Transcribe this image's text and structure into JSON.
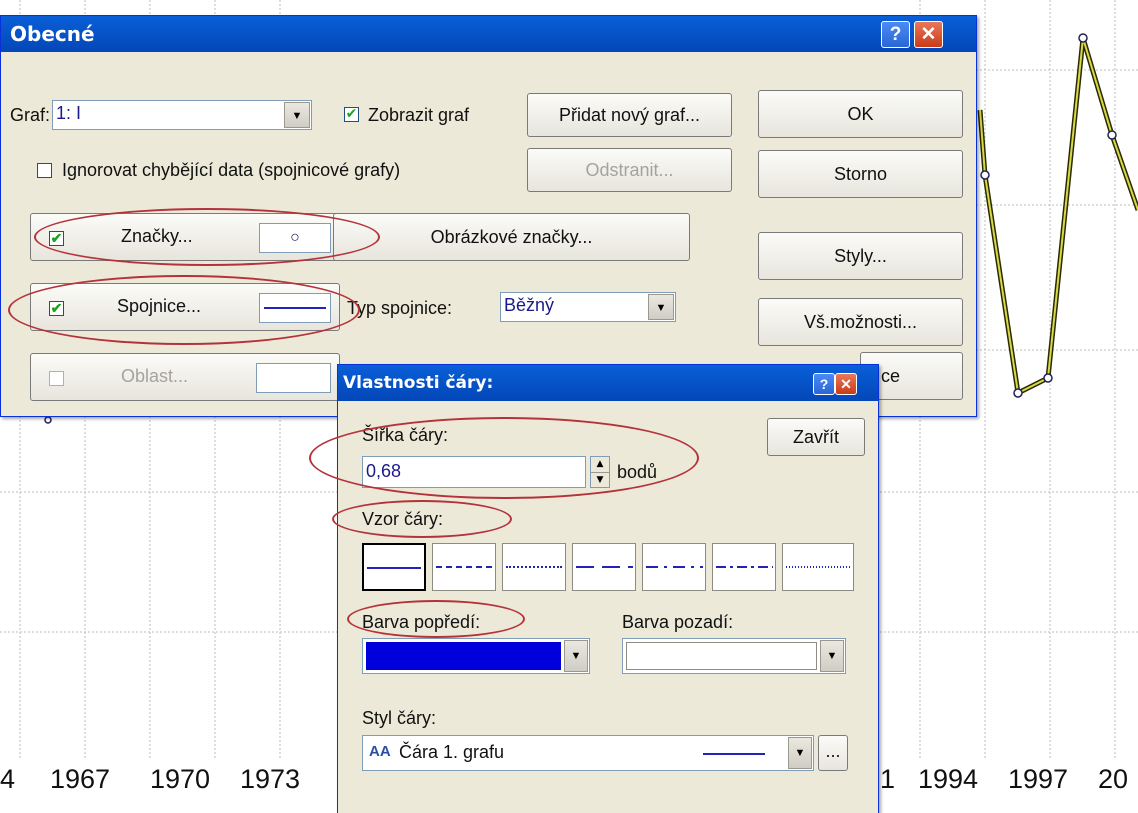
{
  "background_chart": {
    "x_tick_labels": [
      "4",
      "1967",
      "1970",
      "1973",
      "1",
      "1994",
      "1997",
      "20"
    ]
  },
  "dialog_main": {
    "title": "Obecné",
    "graph_label": "Graf:",
    "graph_value": "1: I",
    "show_graph_label": "Zobrazit graf",
    "show_graph_checked": true,
    "add_graph_button": "Přidat nový graf...",
    "ok_button": "OK",
    "ignore_missing_label": "Ignorovat chybějící data (spojnicové grafy)",
    "ignore_missing_checked": false,
    "remove_button": "Odstranit...",
    "cancel_button": "Storno",
    "markers_button": "Značky...",
    "markers_checked": true,
    "marker_preview_symbol": "○",
    "image_markers_button": "Obrázkové značky...",
    "styles_button": "Styly...",
    "lines_button": "Spojnice...",
    "lines_checked": true,
    "line_type_label": "Typ spojnice:",
    "line_type_value": "Běžný",
    "all_options_button": "Vš.možnosti...",
    "area_button": "Oblast...",
    "area_checked": false,
    "partial_button_text": "ce"
  },
  "dialog_line": {
    "title": "Vlastnosti čáry:",
    "width_label": "Šířka čáry:",
    "width_value": "0,68",
    "width_unit": "bodů",
    "close_button": "Zavřít",
    "pattern_label": "Vzor čáry:",
    "patterns": [
      "solid",
      "dashed",
      "dotted",
      "long-dash",
      "dash-dot",
      "dash-dot-dot",
      "fine-dotted"
    ],
    "foreground_label": "Barva popředí:",
    "foreground_color": "#0000dd",
    "background_label": "Barva pozadí:",
    "background_color": "#ffffff",
    "style_label": "Styl čáry:",
    "style_value": "Čára 1. grafu",
    "ellipsis_button": "..."
  },
  "colors": {
    "accent_line": "#2323b8",
    "annotation_red": "#b5323a",
    "chart_series": "#7a7a1c"
  }
}
